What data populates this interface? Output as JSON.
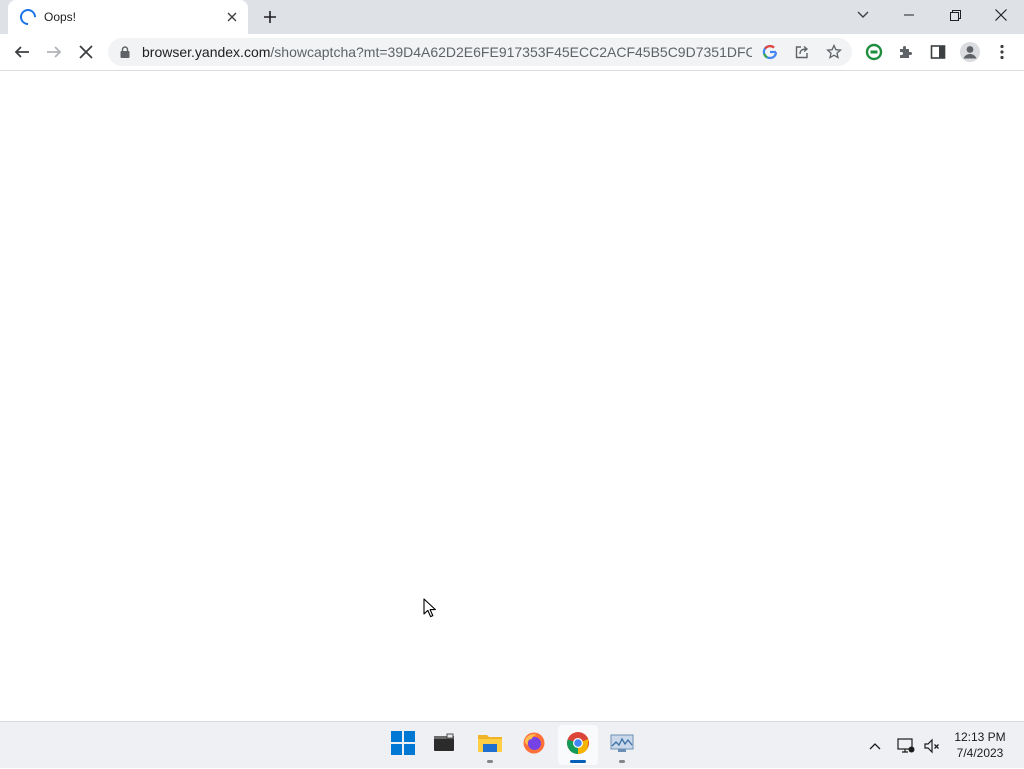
{
  "browser": {
    "tab": {
      "title": "Oops!"
    },
    "address": {
      "host": "browser.yandex.com",
      "path": "/showcaptcha?mt=39D4A62D2E6FE917353F45ECC2ACF45B5C9D7351DFCE7..."
    }
  },
  "taskbar": {
    "apps": [
      "start-icon",
      "terminal-icon",
      "file-explorer-icon",
      "firefox-icon",
      "chrome-icon",
      "system-monitor-icon"
    ],
    "clock": {
      "time": "12:13 PM",
      "date": "7/4/2023"
    }
  },
  "colors": {
    "accent": "#1a73e8",
    "taskbar_active": "#005fb8",
    "extension_green": "#1e8e3e"
  }
}
